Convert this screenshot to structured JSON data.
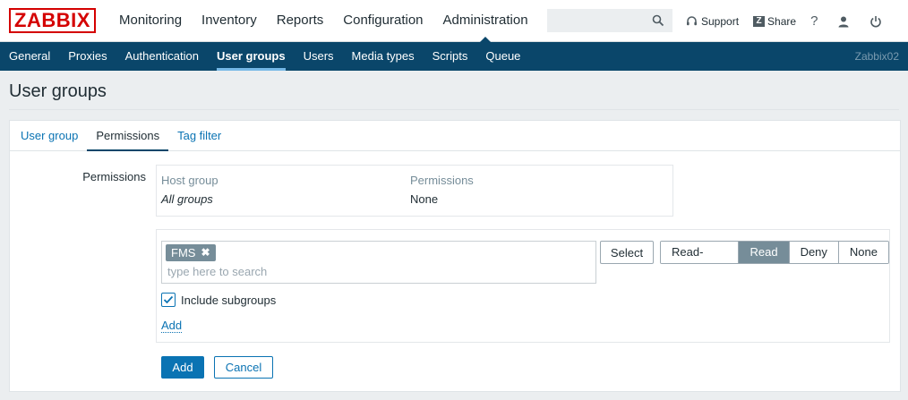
{
  "app": {
    "logo_text": "ZABBIX",
    "brand_color": "#d40000",
    "accent_color": "#0a466a"
  },
  "main_nav": {
    "items": [
      {
        "label": "Monitoring"
      },
      {
        "label": "Inventory"
      },
      {
        "label": "Reports"
      },
      {
        "label": "Configuration"
      },
      {
        "label": "Administration",
        "active": true
      }
    ]
  },
  "search": {
    "value": "",
    "icon": "search-icon"
  },
  "top_links": {
    "support_label": "Support",
    "support_icon": "headset-icon",
    "share_label": "Share",
    "share_icon_text": "Z",
    "help_label": "?",
    "user_icon": "user-icon",
    "logout_icon": "power-icon"
  },
  "sub_nav": {
    "items": [
      {
        "label": "General"
      },
      {
        "label": "Proxies"
      },
      {
        "label": "Authentication"
      },
      {
        "label": "User groups",
        "active": true
      },
      {
        "label": "Users"
      },
      {
        "label": "Media types"
      },
      {
        "label": "Scripts"
      },
      {
        "label": "Queue"
      }
    ],
    "server_name": "Zabbix02"
  },
  "page": {
    "title": "User groups"
  },
  "tabs": [
    {
      "label": "User group"
    },
    {
      "label": "Permissions",
      "active": true
    },
    {
      "label": "Tag filter"
    }
  ],
  "permissions": {
    "field_label": "Permissions",
    "table": {
      "col_host_group": "Host group",
      "col_permissions": "Permissions",
      "row_host_group": "All groups",
      "row_permission": "None"
    },
    "add_form": {
      "chip_label": "FMS",
      "chip_remove": "✖",
      "search_placeholder": "type here to search",
      "select_button": "Select",
      "options": [
        {
          "label": "Read-write"
        },
        {
          "label": "Read",
          "selected": true
        },
        {
          "label": "Deny"
        },
        {
          "label": "None"
        }
      ],
      "include_subgroups_label": "Include subgroups",
      "include_subgroups_checked": true,
      "add_link": "Add"
    }
  },
  "actions": {
    "add_label": "Add",
    "cancel_label": "Cancel"
  }
}
